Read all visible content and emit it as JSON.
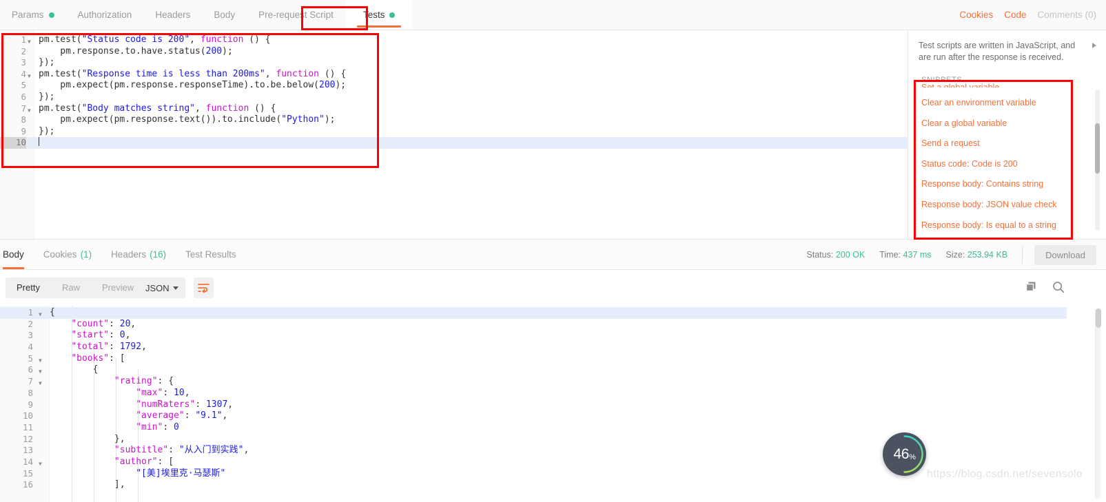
{
  "request_tabs": {
    "items": [
      {
        "label": "Params",
        "dot": true,
        "active": false
      },
      {
        "label": "Authorization",
        "dot": false,
        "active": false
      },
      {
        "label": "Headers",
        "dot": false,
        "active": false
      },
      {
        "label": "Body",
        "dot": false,
        "active": false
      },
      {
        "label": "Pre-request Script",
        "dot": false,
        "active": false
      },
      {
        "label": "Tests",
        "dot": true,
        "active": true
      }
    ],
    "right_links": [
      {
        "label": "Cookies",
        "style": "orange"
      },
      {
        "label": "Code",
        "style": "orange"
      },
      {
        "label": "Comments (0)",
        "style": "grey"
      }
    ]
  },
  "editor": {
    "active_line": 10,
    "lines": [
      {
        "n": "1",
        "fold": true,
        "text": "pm.test(\"Status code is 200\", function () {"
      },
      {
        "n": "2",
        "fold": false,
        "text": "    pm.response.to.have.status(200);"
      },
      {
        "n": "3",
        "fold": false,
        "text": "});"
      },
      {
        "n": "4",
        "fold": true,
        "text": "pm.test(\"Response time is less than 200ms\", function () {"
      },
      {
        "n": "5",
        "fold": false,
        "text": "    pm.expect(pm.response.responseTime).to.be.below(200);"
      },
      {
        "n": "6",
        "fold": false,
        "text": "});"
      },
      {
        "n": "7",
        "fold": true,
        "text": "pm.test(\"Body matches string\", function () {"
      },
      {
        "n": "8",
        "fold": false,
        "text": "    pm.expect(pm.response.text()).to.include(\"Python\");"
      },
      {
        "n": "9",
        "fold": false,
        "text": "});"
      },
      {
        "n": "10",
        "fold": false,
        "text": ""
      }
    ]
  },
  "side_panel": {
    "description": "Test scripts are written in JavaScript, and are run after the response is received.",
    "snippets_header": "SNIPPETS",
    "snippets": [
      "Set a global variable",
      "Clear an environment variable",
      "Clear a global variable",
      "Send a request",
      "Status code: Code is 200",
      "Response body: Contains string",
      "Response body: JSON value check",
      "Response body: Is equal to a string"
    ]
  },
  "response_tabs": {
    "items": [
      {
        "label": "Body",
        "count": "",
        "active": true
      },
      {
        "label": "Cookies",
        "count": "(1)",
        "active": false
      },
      {
        "label": "Headers",
        "count": "(16)",
        "active": false
      },
      {
        "label": "Test Results",
        "count": "",
        "active": false
      }
    ],
    "meta": [
      {
        "label": "Status:",
        "value": "200 OK"
      },
      {
        "label": "Time:",
        "value": "437 ms"
      },
      {
        "label": "Size:",
        "value": "253.94 KB"
      }
    ],
    "download_label": "Download"
  },
  "body_toolbar": {
    "views": [
      {
        "label": "Pretty",
        "active": true
      },
      {
        "label": "Raw",
        "active": false
      },
      {
        "label": "Preview",
        "active": false
      }
    ],
    "format": "JSON",
    "wrap_icon": "word-wrap-icon",
    "copy_icon": "copy-icon",
    "search_icon": "search-icon"
  },
  "body": {
    "active_line": 1,
    "lines": [
      {
        "n": "1",
        "fold": true,
        "text": "{"
      },
      {
        "n": "2",
        "fold": false,
        "text": "    \"count\": 20,"
      },
      {
        "n": "3",
        "fold": false,
        "text": "    \"start\": 0,"
      },
      {
        "n": "4",
        "fold": false,
        "text": "    \"total\": 1792,"
      },
      {
        "n": "5",
        "fold": true,
        "text": "    \"books\": ["
      },
      {
        "n": "6",
        "fold": true,
        "text": "        {"
      },
      {
        "n": "7",
        "fold": true,
        "text": "            \"rating\": {"
      },
      {
        "n": "8",
        "fold": false,
        "text": "                \"max\": 10,"
      },
      {
        "n": "9",
        "fold": false,
        "text": "                \"numRaters\": 1307,"
      },
      {
        "n": "10",
        "fold": false,
        "text": "                \"average\": \"9.1\","
      },
      {
        "n": "11",
        "fold": false,
        "text": "                \"min\": 0"
      },
      {
        "n": "12",
        "fold": false,
        "text": "            },"
      },
      {
        "n": "13",
        "fold": false,
        "text": "            \"subtitle\": \"从入门到实践\","
      },
      {
        "n": "14",
        "fold": true,
        "text": "            \"author\": ["
      },
      {
        "n": "15",
        "fold": false,
        "text": "                \"[美]埃里克·马瑟斯\""
      },
      {
        "n": "16",
        "fold": false,
        "text": "            ],"
      }
    ]
  },
  "progress_widget": {
    "value": "46",
    "unit": "%"
  },
  "watermark": "https://blog.csdn.net/sevensolo",
  "colors": {
    "accent_orange": "#f2703a",
    "status_green": "#3dbf8e",
    "annotation_red": "#fe0000",
    "progress_bg": "#4b5360"
  }
}
